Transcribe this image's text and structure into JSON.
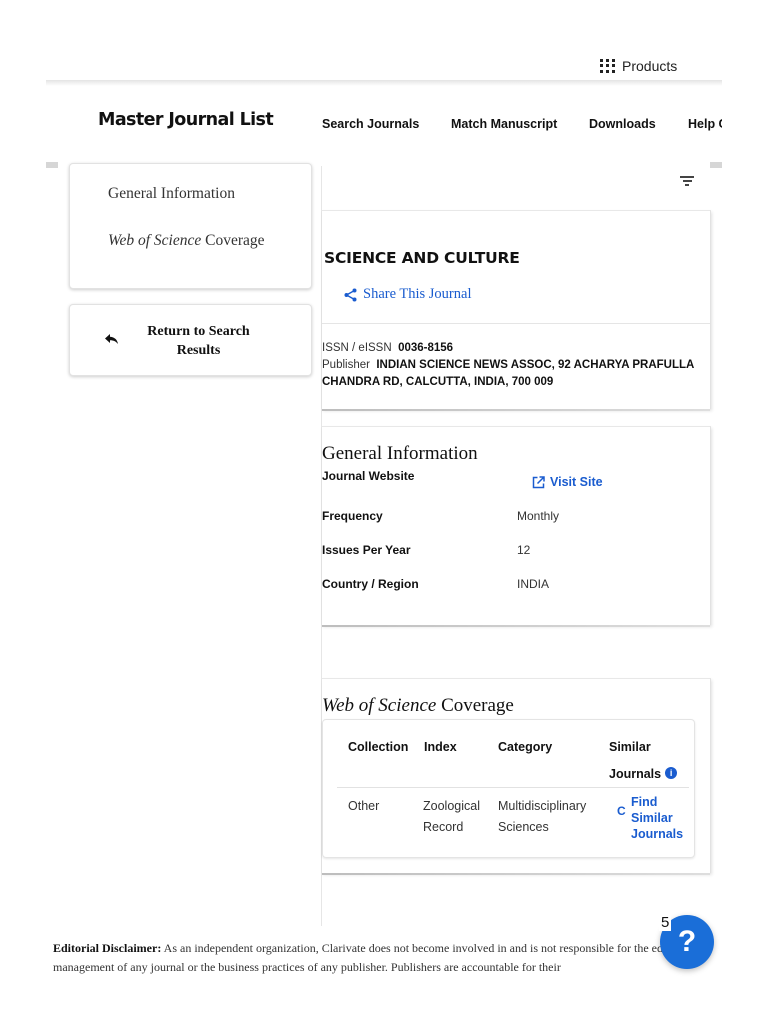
{
  "topbar": {
    "products_label": "Products"
  },
  "nav": {
    "brand": "Master Journal List",
    "links": [
      "Search Journals",
      "Match Manuscript",
      "Downloads",
      "Help Center"
    ]
  },
  "toc": {
    "general_info": "General Information",
    "coverage_em": "Web of Science",
    "coverage_rest": " Coverage"
  },
  "return_label": "Return to Search Results",
  "journal": {
    "title": "SCIENCE AND CULTURE",
    "share_label": "Share This Journal",
    "issn_label": "ISSN / eISSN",
    "issn_value": "0036-8156",
    "publisher_label": "Publisher",
    "publisher_line1": "INDIAN SCIENCE NEWS ASSOC, 92 ACHARYA PRAFULLA",
    "publisher_line2": "CHANDRA RD, CALCUTTA, INDIA, 700 009"
  },
  "general_information": {
    "title": "General Information",
    "website_label": "Journal Website",
    "visit_label": "Visit Site",
    "frequency_label": "Frequency",
    "frequency_value": "Monthly",
    "issues_label": "Issues Per Year",
    "issues_value": "12",
    "country_label": "Country / Region",
    "country_value": "INDIA"
  },
  "coverage": {
    "title_em": "Web of Science",
    "title_rest": " Coverage",
    "headers": {
      "collection": "Collection",
      "index": "Index",
      "category": "Category",
      "similar": "Similar Journals"
    },
    "rows": [
      {
        "collection": "Other",
        "index": "Zoological Record",
        "category": "Multidisciplinary Sciences",
        "similar_link": "Find Similar Journals"
      }
    ]
  },
  "footer": {
    "disclaimer_bold": "Editorial Disclaimer:",
    "disclaimer_text": " As an independent organization, Clarivate does not become involved in and is not responsible for the editorial management of any journal or the business practices of any publisher. Publishers are accountable for their",
    "help_badge": "5",
    "help_icon": "?"
  },
  "colors": {
    "link_blue": "#1a5ccf",
    "help_button": "#1a6ed8"
  }
}
